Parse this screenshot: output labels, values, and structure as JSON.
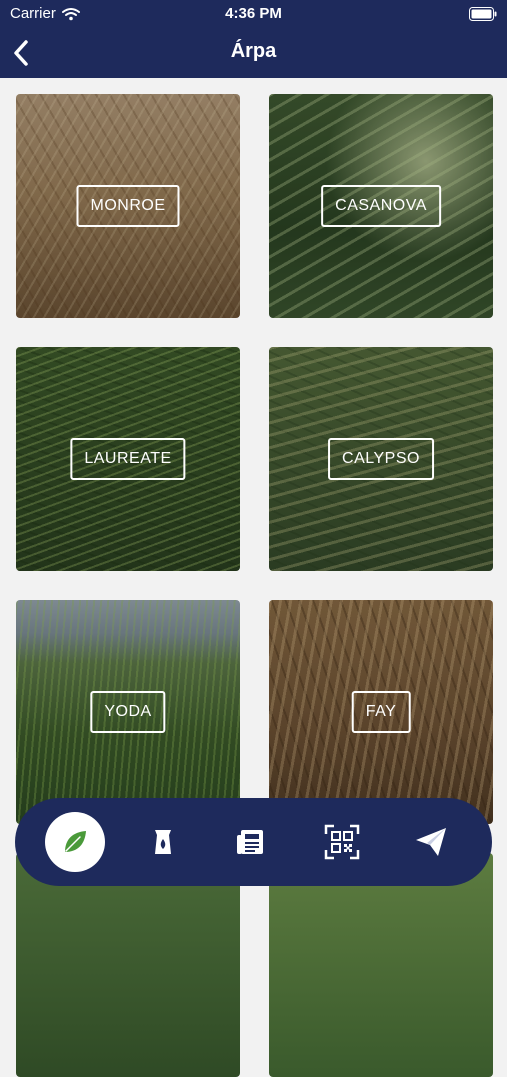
{
  "status_bar": {
    "carrier": "Carrier",
    "time": "4:36 PM"
  },
  "nav": {
    "title": "Árpa",
    "back_icon": "chevron-left-icon"
  },
  "varieties": [
    {
      "label": "MONROE"
    },
    {
      "label": "CASANOVA"
    },
    {
      "label": "LAUREATE"
    },
    {
      "label": "CALYPSO"
    },
    {
      "label": "YODA"
    },
    {
      "label": "FAY"
    }
  ],
  "tab_bar": {
    "items": [
      {
        "icon": "leaf-icon",
        "active": true
      },
      {
        "icon": "seed-bag-icon",
        "active": false
      },
      {
        "icon": "newspaper-icon",
        "active": false
      },
      {
        "icon": "qr-code-icon",
        "active": false
      },
      {
        "icon": "paper-plane-icon",
        "active": false
      }
    ]
  },
  "colors": {
    "brand_navy": "#1e2a5c",
    "background": "#f2f2f2",
    "active_leaf": "#4a9a3a",
    "label_text": "#ffffff"
  }
}
